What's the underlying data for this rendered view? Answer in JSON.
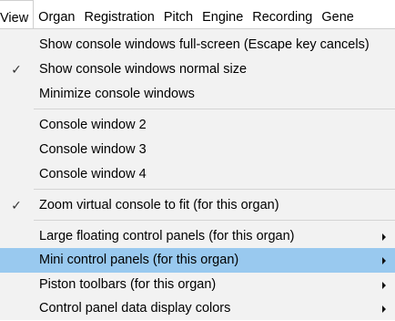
{
  "menubar": {
    "items": [
      {
        "label": "View"
      },
      {
        "label": "Organ"
      },
      {
        "label": "Registration"
      },
      {
        "label": "Pitch"
      },
      {
        "label": "Engine"
      },
      {
        "label": "Recording"
      },
      {
        "label": "Gene"
      }
    ]
  },
  "menu": {
    "items": [
      {
        "label": "Show console windows full-screen (Escape key cancels)",
        "checked": false,
        "submenu": false
      },
      {
        "label": "Show console windows normal size",
        "checked": true,
        "check_icon": "checkmark-icon",
        "submenu": false
      },
      {
        "label": "Minimize console windows",
        "checked": false,
        "submenu": false
      },
      {
        "label": "Console window 2",
        "checked": false,
        "submenu": false
      },
      {
        "label": "Console window 3",
        "checked": false,
        "submenu": false
      },
      {
        "label": "Console window 4",
        "checked": false,
        "submenu": false
      },
      {
        "label": "Zoom virtual console to fit (for this organ)",
        "checked": true,
        "check_icon": "checkmark-icon",
        "submenu": false
      },
      {
        "label": "Large floating control panels (for this organ)",
        "checked": false,
        "submenu": true,
        "submenu_icon": "submenu-arrow-icon"
      },
      {
        "label": "Mini control panels (for this organ)",
        "checked": false,
        "submenu": true,
        "submenu_icon": "submenu-arrow-icon",
        "highlighted": true
      },
      {
        "label": "Piston toolbars (for this organ)",
        "checked": false,
        "submenu": true,
        "submenu_icon": "submenu-arrow-icon"
      },
      {
        "label": "Control panel data display colors",
        "checked": false,
        "submenu": true,
        "submenu_icon": "submenu-arrow-icon"
      }
    ],
    "check_glyph": "✓",
    "highlight_color": "#99c9ef",
    "menu_background": "#f2f2f2"
  }
}
